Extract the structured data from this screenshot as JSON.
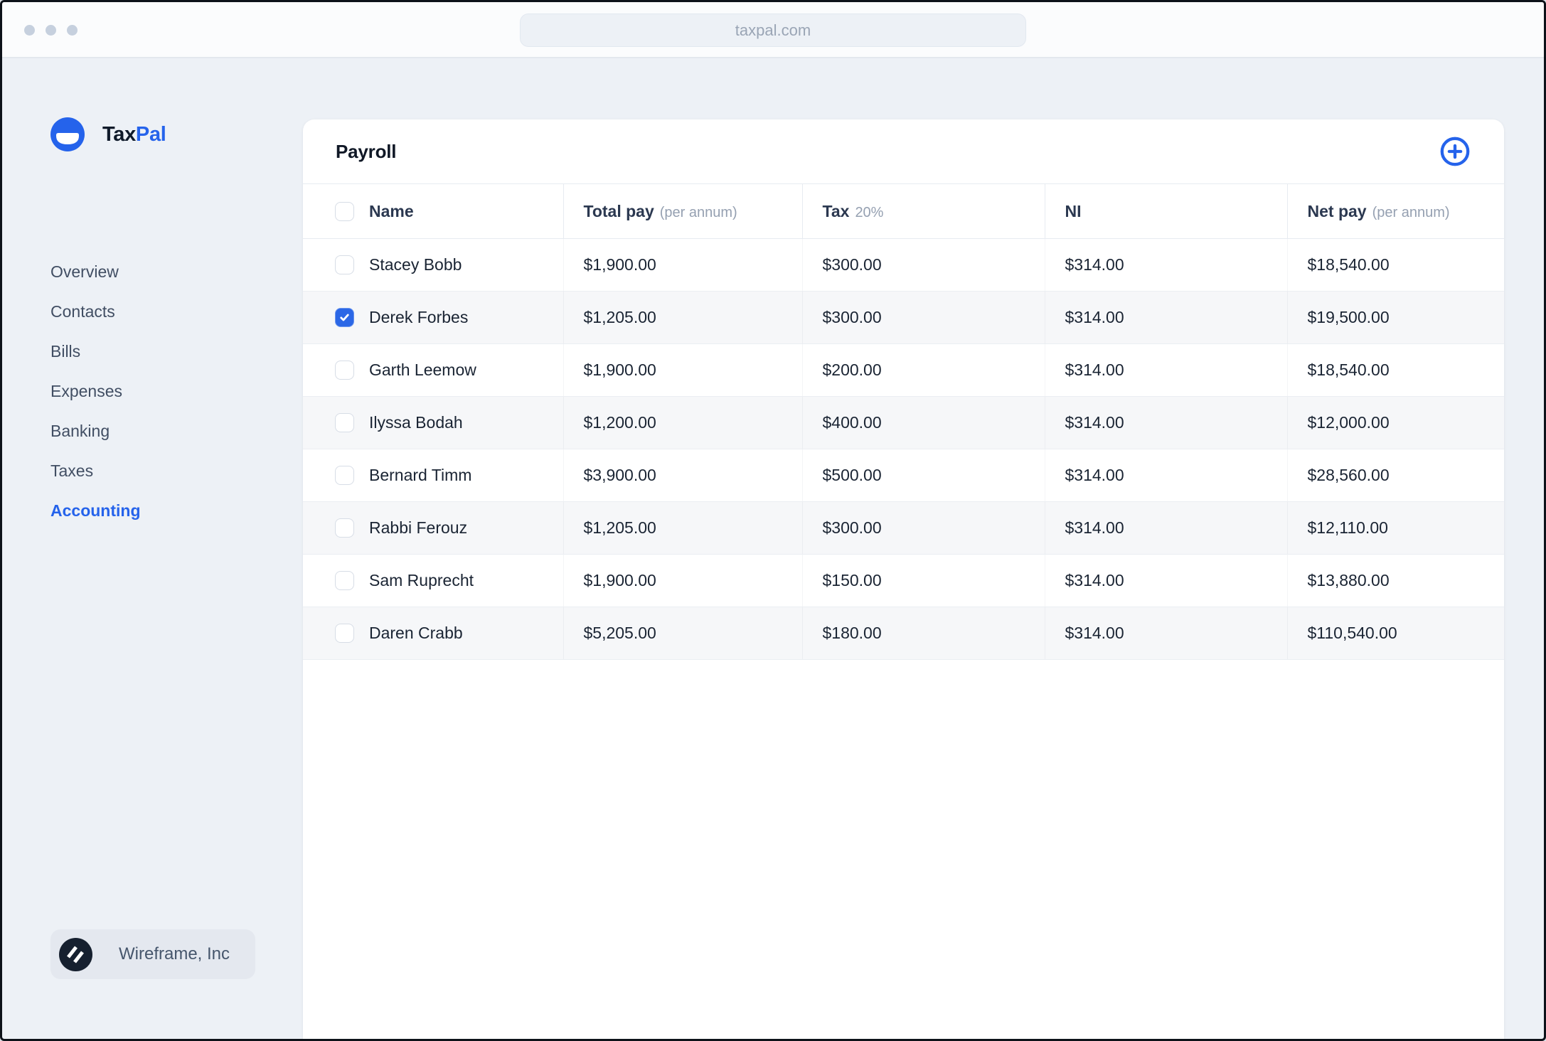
{
  "browser": {
    "url": "taxpal.com"
  },
  "brand": {
    "name_primary": "Tax",
    "name_secondary": "Pal"
  },
  "nav": {
    "items": [
      {
        "label": "Overview",
        "active": false
      },
      {
        "label": "Contacts",
        "active": false
      },
      {
        "label": "Bills",
        "active": false
      },
      {
        "label": "Expenses",
        "active": false
      },
      {
        "label": "Banking",
        "active": false
      },
      {
        "label": "Taxes",
        "active": false
      },
      {
        "label": "Accounting",
        "active": true
      }
    ]
  },
  "footer": {
    "company": "Wireframe, Inc"
  },
  "card": {
    "title": "Payroll",
    "add_icon": "circle-plus-icon"
  },
  "table": {
    "columns": {
      "name": {
        "label": "Name"
      },
      "total_pay": {
        "label": "Total pay",
        "suffix": "(per annum)"
      },
      "tax": {
        "label": "Tax",
        "suffix": "20%"
      },
      "ni": {
        "label": "NI"
      },
      "net_pay": {
        "label": "Net pay",
        "suffix": "(per annum)"
      }
    },
    "rows": [
      {
        "name": "Stacey Bobb",
        "total_pay": "$1,900.00",
        "tax": "$300.00",
        "ni": "$314.00",
        "net_pay": "$18,540.00",
        "checked": false
      },
      {
        "name": "Derek Forbes",
        "total_pay": "$1,205.00",
        "tax": "$300.00",
        "ni": "$314.00",
        "net_pay": "$19,500.00",
        "checked": true
      },
      {
        "name": "Garth Leemow",
        "total_pay": "$1,900.00",
        "tax": "$200.00",
        "ni": "$314.00",
        "net_pay": "$18,540.00",
        "checked": false
      },
      {
        "name": "Ilyssa Bodah",
        "total_pay": "$1,200.00",
        "tax": "$400.00",
        "ni": "$314.00",
        "net_pay": "$12,000.00",
        "checked": false
      },
      {
        "name": "Bernard Timm",
        "total_pay": "$3,900.00",
        "tax": "$500.00",
        "ni": "$314.00",
        "net_pay": "$28,560.00",
        "checked": false
      },
      {
        "name": "Rabbi Ferouz",
        "total_pay": "$1,205.00",
        "tax": "$300.00",
        "ni": "$314.00",
        "net_pay": "$12,110.00",
        "checked": false
      },
      {
        "name": "Sam Ruprecht",
        "total_pay": "$1,900.00",
        "tax": "$150.00",
        "ni": "$314.00",
        "net_pay": "$13,880.00",
        "checked": false
      },
      {
        "name": "Daren Crabb",
        "total_pay": "$5,205.00",
        "tax": "$180.00",
        "ni": "$314.00",
        "net_pay": "$110,540.00",
        "checked": false
      }
    ]
  },
  "colors": {
    "accent": "#2563eb",
    "active_nav": "#2563eb",
    "checked_checkbox": "#2b67e6",
    "stripe_row": "#f6f7f9",
    "page_background": "#edf1f6"
  }
}
